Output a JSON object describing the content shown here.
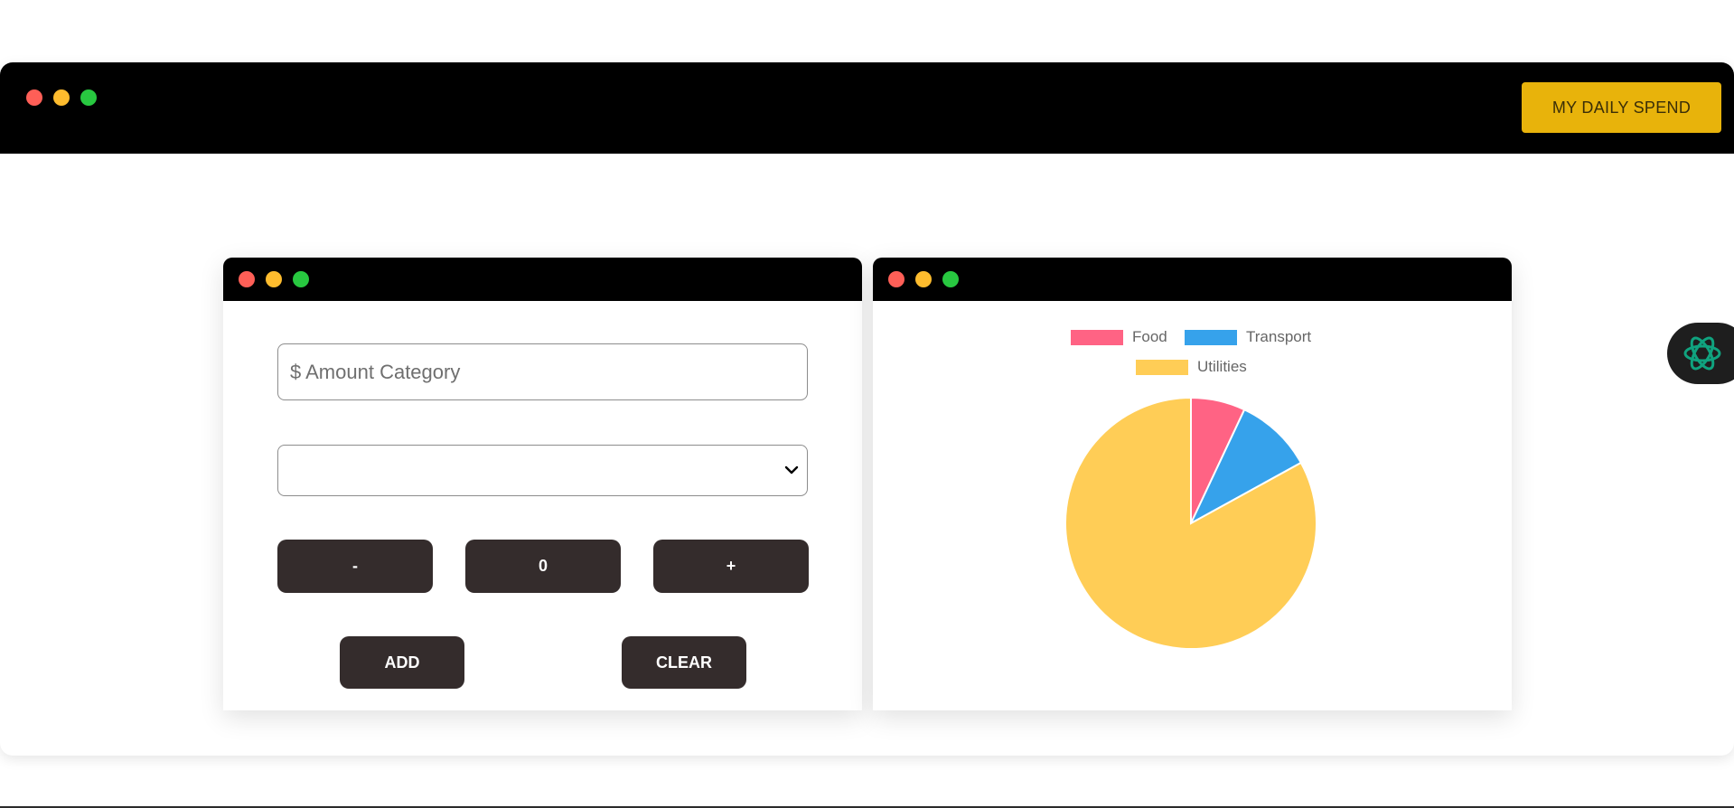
{
  "header": {
    "brand_button_label": "MY DAILY SPEND"
  },
  "form": {
    "amount_placeholder": "$ Amount Category",
    "category_selected": "",
    "stepper": {
      "minus_label": "-",
      "value": "0",
      "plus_label": "+"
    },
    "add_label": "ADD",
    "clear_label": "CLEAR"
  },
  "icons": {
    "window_controls": [
      "close-dot",
      "minimize-dot",
      "maximize-dot"
    ],
    "select": "chevron-down-icon",
    "assistant": "openai-icon"
  },
  "colors": {
    "header": "#000000",
    "brand_button": "#e8b30b",
    "dark_button": "#342c2c",
    "control_close": "#ff5f57",
    "control_minimize": "#febc2e",
    "control_maximize": "#28c840",
    "assistant_icon": "#10a37f"
  },
  "chart_data": {
    "type": "pie",
    "labels": [
      "Food",
      "Transport",
      "Utilities"
    ],
    "values": [
      7,
      10,
      83
    ],
    "colors": [
      "#ff6384",
      "#36a2eb",
      "#ffcd56"
    ],
    "legend_position": "top"
  }
}
